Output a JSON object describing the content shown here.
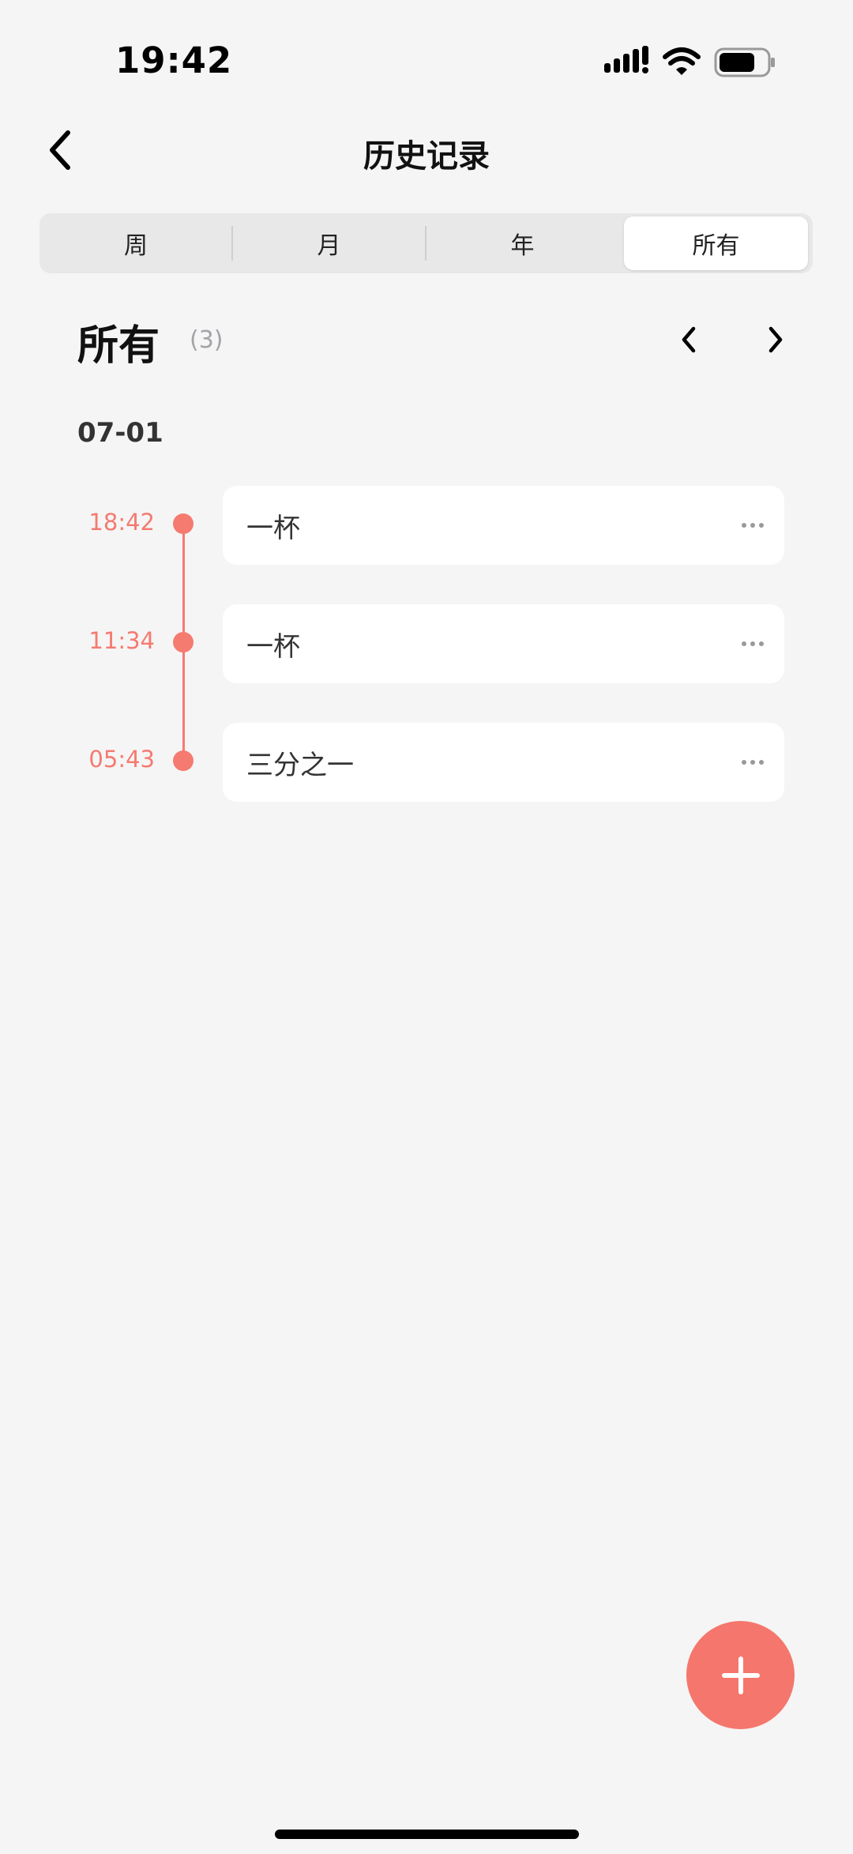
{
  "status_bar": {
    "time": "19:42",
    "icons": [
      "signal-icon",
      "wifi-icon",
      "battery-icon"
    ]
  },
  "nav": {
    "title": "历史记录",
    "back_icon": "chevron-left-icon"
  },
  "segmented": {
    "options": [
      "周",
      "月",
      "年",
      "所有"
    ],
    "selected": "所有"
  },
  "section": {
    "title": "所有",
    "count": "(3)",
    "prev_icon": "chevron-left-icon",
    "next_icon": "chevron-right-icon"
  },
  "groups": [
    {
      "date": "07-01",
      "entries": [
        {
          "time": "18:42",
          "label": "一杯"
        },
        {
          "time": "11:34",
          "label": "一杯"
        },
        {
          "time": "05:43",
          "label": "三分之一"
        }
      ]
    }
  ],
  "fab": {
    "icon": "plus-icon"
  },
  "colors": {
    "accent": "#f57a70",
    "background": "#f5f5f5",
    "card": "#ffffff",
    "count_text": "#a3a3a8"
  }
}
